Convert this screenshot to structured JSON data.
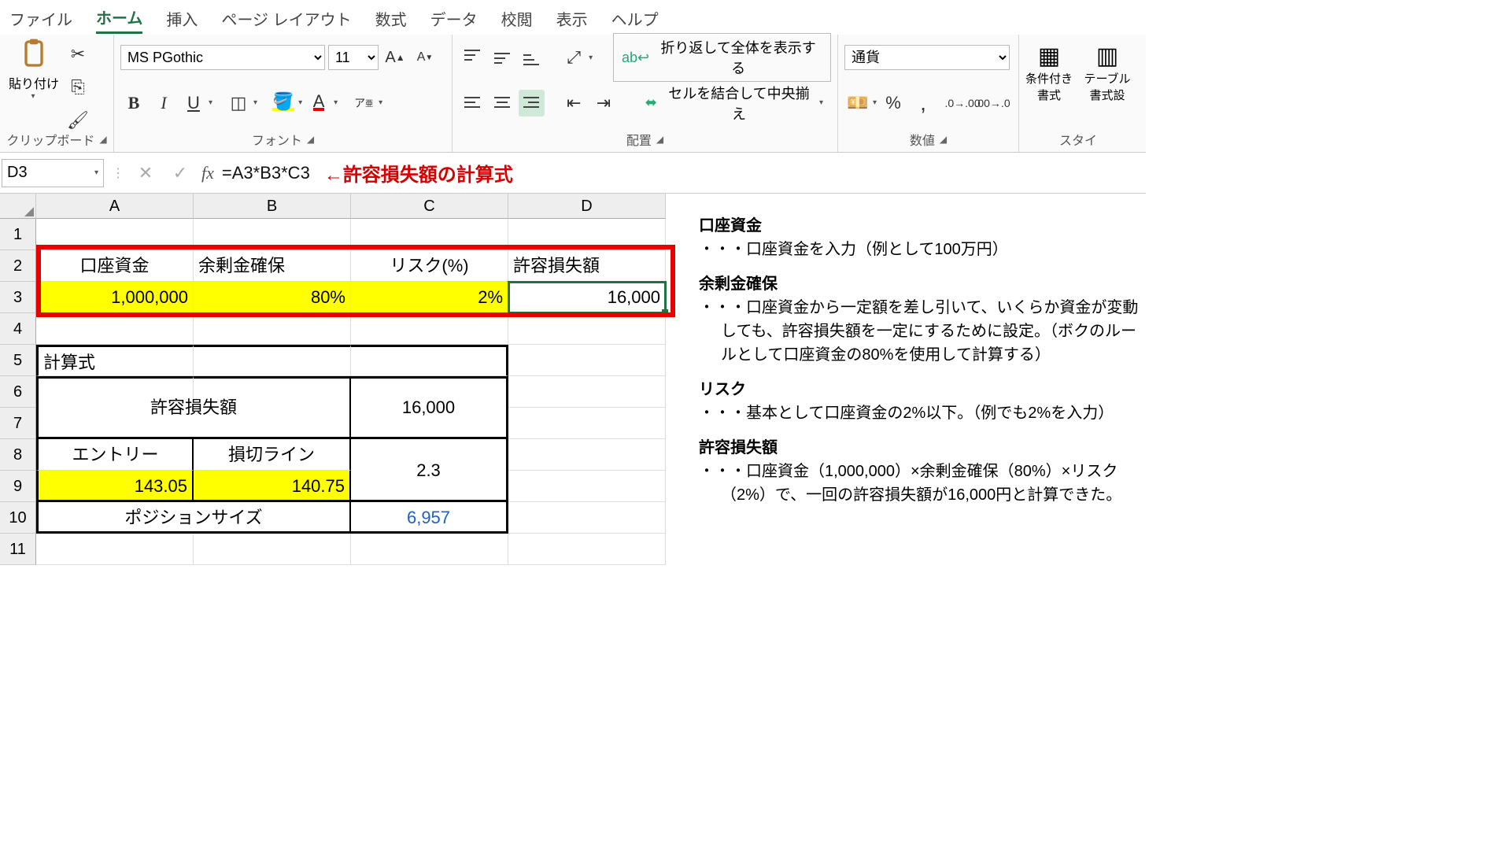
{
  "tabs": {
    "file": "ファイル",
    "home": "ホーム",
    "insert": "挿入",
    "pagelayout": "ページ レイアウト",
    "formulas": "数式",
    "data": "データ",
    "review": "校閲",
    "view": "表示",
    "help": "ヘルプ"
  },
  "clip": {
    "paste": "貼り付け",
    "group": "クリップボード"
  },
  "font": {
    "name": "MS PGothic",
    "size": "11",
    "group": "フォント"
  },
  "align": {
    "group": "配置",
    "wrap": "折り返して全体を表示する",
    "merge": "セルを結合して中央揃え"
  },
  "number": {
    "group": "数値",
    "format": "通貨"
  },
  "styles": {
    "cond": "条件付き\n書式",
    "table": "テーブル\n書式設",
    "group": "スタイ"
  },
  "namebox": "D3",
  "formula": "=A3*B3*C3",
  "annot": "←許容損失額の計算式",
  "cells": {
    "A2": "口座資金",
    "B2": "余剰金確保",
    "C2": "リスク(%)",
    "D2": "許容損失額",
    "A3": "1,000,000",
    "B3": "80%",
    "C3": "2%",
    "D3": "16,000",
    "A5": "計算式",
    "AB67": "許容損失額",
    "C67": "16,000",
    "A8": "エントリー",
    "B8": "損切ライン",
    "C89": "2.3",
    "A9": "143.05",
    "B9": "140.75",
    "AB10": "ポジションサイズ",
    "C10": "6,957"
  },
  "notes": {
    "h1": "口座資金",
    "p1": "口座資金を入力（例として100万円）",
    "h2": "余剰金確保",
    "p2": "口座資金から一定額を差し引いて、いくらか資金が変動しても、許容損失額を一定にするために設定。（ボクのルールとして口座資金の80%を使用して計算する）",
    "h3": "リスク",
    "p3": "基本として口座資金の2%以下。（例でも2%を入力）",
    "h4": "許容損失額",
    "p4": "口座資金（1,000,000）×余剰金確保（80%）×リスク（2%）で、一回の許容損失額が16,000円と計算できた。"
  }
}
